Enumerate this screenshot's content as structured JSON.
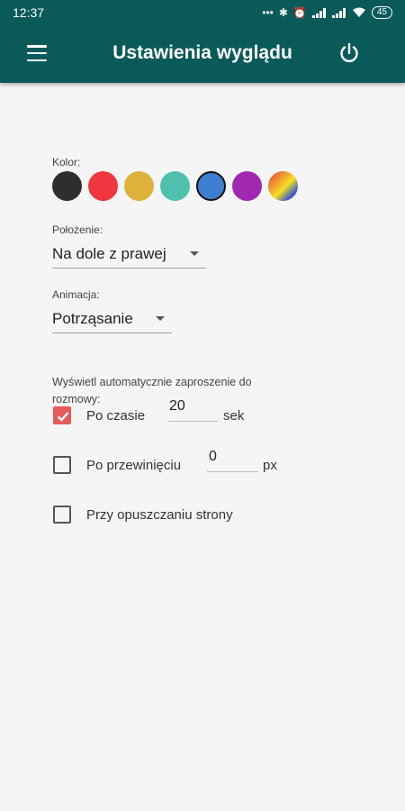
{
  "status_bar": {
    "time": "12:37",
    "battery": "45"
  },
  "app_bar": {
    "title": "Ustawienia wyglądu"
  },
  "color_section": {
    "label": "Kolor:",
    "swatches": [
      {
        "color": "#2e2e2e"
      },
      {
        "color": "#f0363f"
      },
      {
        "color": "#deb23a"
      },
      {
        "color": "#4fc0ae"
      },
      {
        "color": "#3d7fd0",
        "selected": true
      },
      {
        "color": "#a128b0"
      },
      {
        "color": "gradient"
      }
    ]
  },
  "position": {
    "label": "Położenie:",
    "value": "Na dole z prawej"
  },
  "animation": {
    "label": "Animacja:",
    "value": "Potrząsanie"
  },
  "invite": {
    "description": "Wyświetl automatycznie zaproszenie do rozmowy:",
    "options": [
      {
        "label": "Po czasie",
        "checked": true,
        "value": "20",
        "unit": "sek"
      },
      {
        "label": "Po przewinięciu",
        "checked": false,
        "value": "0",
        "unit": "px"
      },
      {
        "label": "Przy opuszczaniu strony",
        "checked": false
      }
    ]
  }
}
